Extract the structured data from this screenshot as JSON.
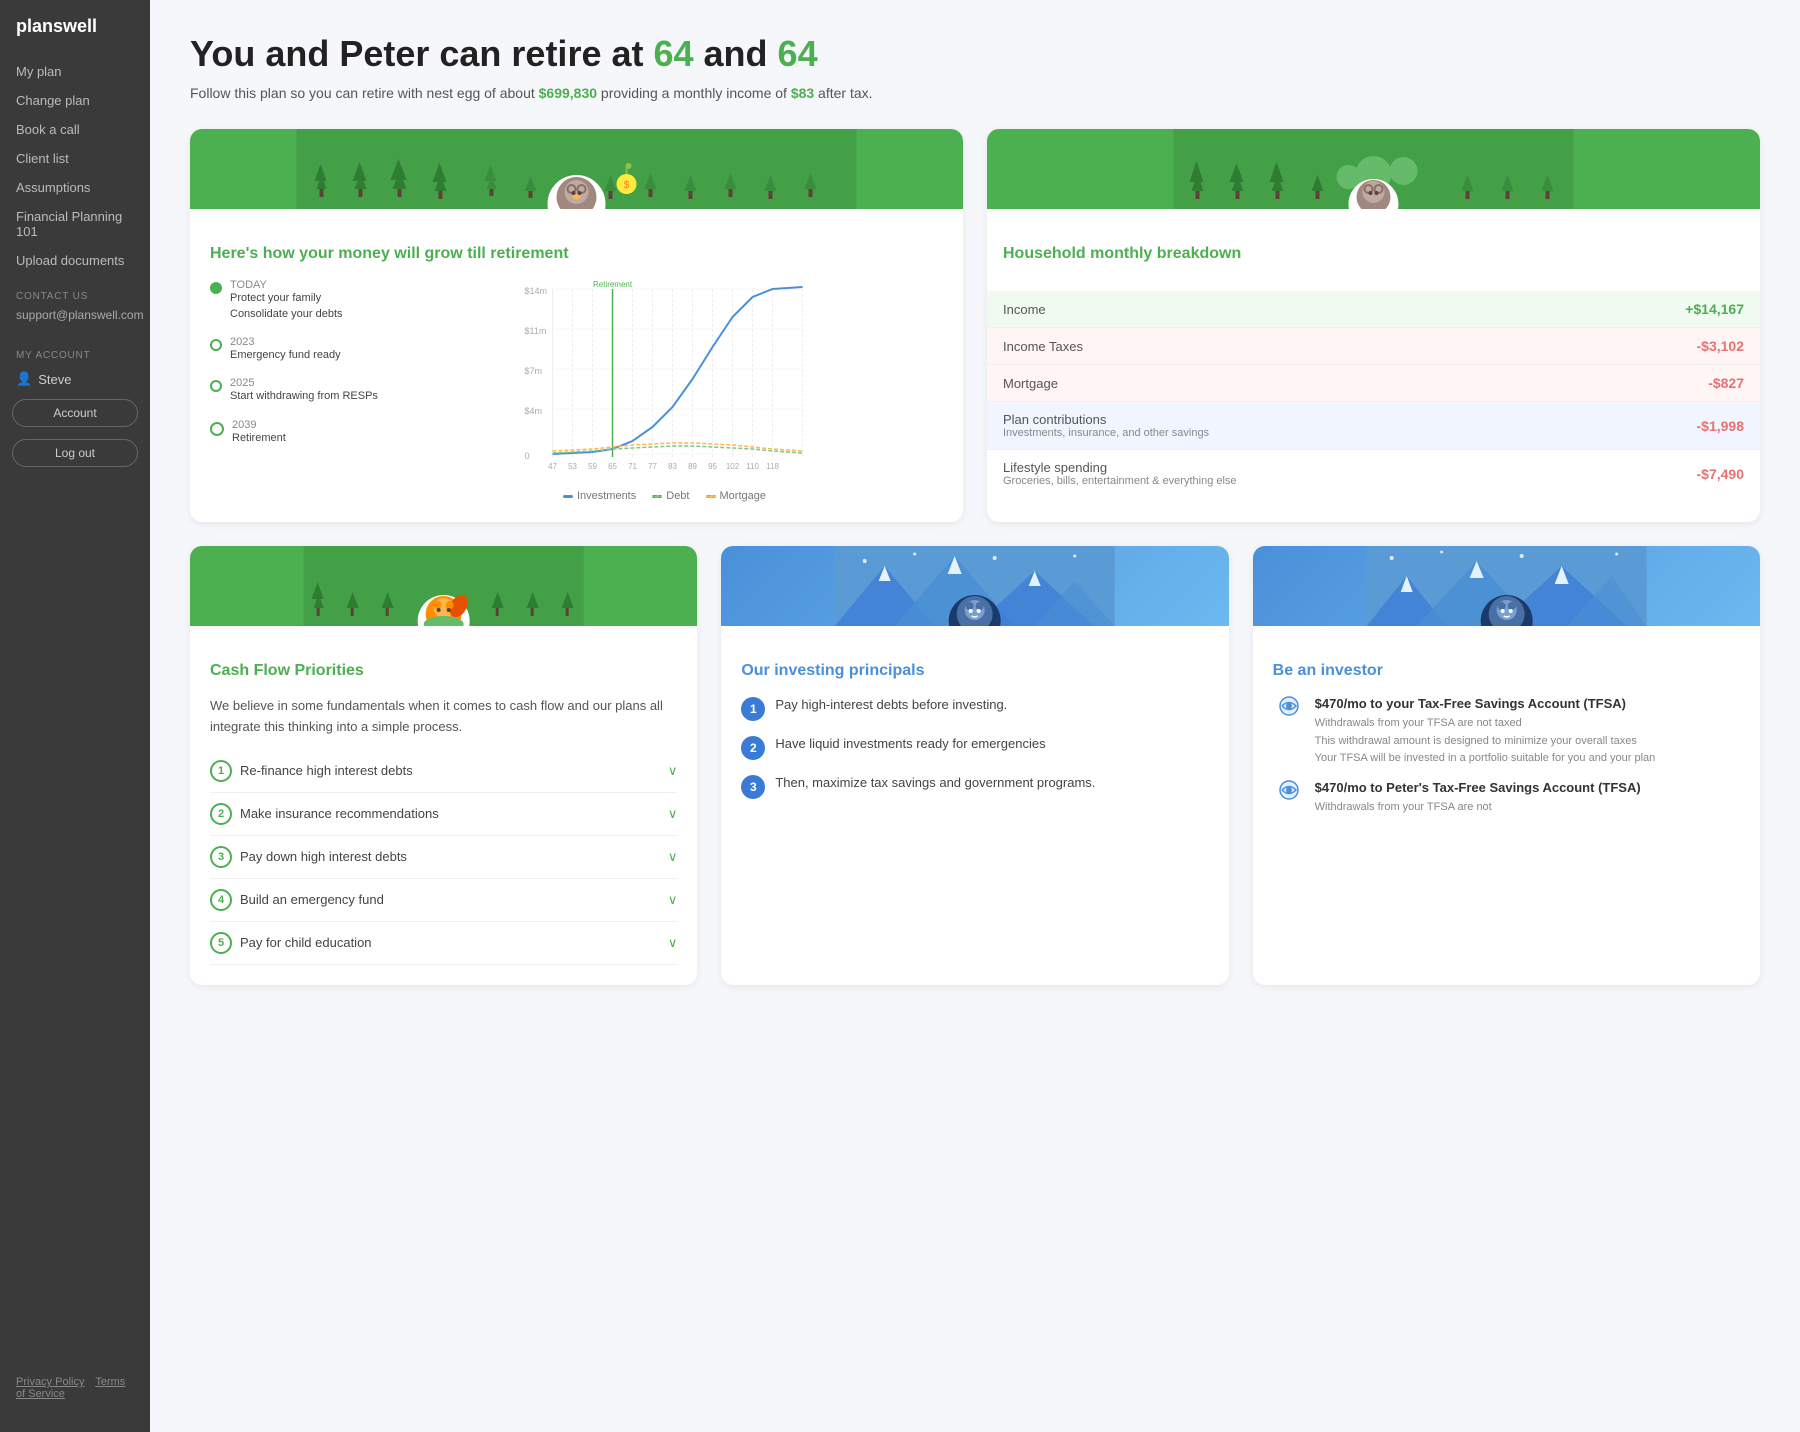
{
  "brand": "planswell",
  "sidebar": {
    "nav": [
      {
        "label": "My plan",
        "id": "my-plan"
      },
      {
        "label": "Change plan",
        "id": "change-plan"
      },
      {
        "label": "Book a call",
        "id": "book-call"
      },
      {
        "label": "Client list",
        "id": "client-list"
      },
      {
        "label": "Assumptions",
        "id": "assumptions"
      },
      {
        "label": "Financial Planning 101",
        "id": "fp101"
      },
      {
        "label": "Upload documents",
        "id": "upload-docs"
      }
    ],
    "contact_label": "CONTACT US",
    "contact_email": "support@planswell.com",
    "account_label": "MY ACCOUNT",
    "user_name": "Steve",
    "account_btn": "Account",
    "logout_btn": "Log out",
    "footer_links": [
      "Privacy Policy",
      "Terms of Service"
    ]
  },
  "hero": {
    "title_prefix": "You and Peter can retire at ",
    "age1": "64",
    "title_mid": " and ",
    "age2": "64",
    "subtitle_prefix": "Follow this plan so you can retire with nest egg of about ",
    "nest_egg": "$699,830",
    "subtitle_mid": " providing a monthly income of ",
    "monthly_income": "$83",
    "subtitle_suffix": " after tax."
  },
  "growth_card": {
    "title": "Here's how your money will grow till retirement",
    "timeline": [
      {
        "year": "TODAY",
        "filled": true,
        "events": [
          "Protect your family",
          "Consolidate your debts"
        ]
      },
      {
        "year": "2023",
        "filled": false,
        "events": [
          "Emergency fund ready"
        ]
      },
      {
        "year": "2025",
        "filled": false,
        "events": [
          "Start withdrawing from RESPs"
        ]
      },
      {
        "year": "2039",
        "filled": false,
        "events": [
          "Retirement"
        ]
      }
    ],
    "chart": {
      "y_labels": [
        "$14m",
        "$11m",
        "$7m",
        "$4m",
        "0"
      ],
      "x_labels": [
        "47",
        "53",
        "59",
        "65",
        "71",
        "77",
        "83",
        "89",
        "95",
        "102",
        "110",
        "118"
      ],
      "retirement_label": "Retirement"
    },
    "legend": [
      {
        "label": "Investments",
        "color": "blue"
      },
      {
        "label": "Debt",
        "color": "green"
      },
      {
        "label": "Mortgage",
        "color": "orange"
      }
    ]
  },
  "household_card": {
    "title": "Household monthly breakdown",
    "rows": [
      {
        "label": "Income",
        "amount": "+$14,167",
        "type": "green",
        "bg": "bg-green"
      },
      {
        "label": "Income Taxes",
        "amount": "-$3,102",
        "type": "red",
        "bg": "bg-red"
      },
      {
        "label": "Mortgage",
        "amount": "-$827",
        "type": "red",
        "bg": "bg-red"
      },
      {
        "label": "Plan contributions",
        "sublabel": "Investments, insurance, and other savings",
        "amount": "-$1,998",
        "type": "red",
        "bg": "bg-blue"
      },
      {
        "label": "Lifestyle spending",
        "sublabel": "Groceries, bills, entertainment & everything else",
        "amount": "-$7,490",
        "type": "red",
        "bg": ""
      }
    ]
  },
  "cashflow_card": {
    "title": "Cash Flow Priorities",
    "description": "We believe in some fundamentals when it comes to cash flow and our plans all integrate this thinking into a simple process.",
    "items": [
      {
        "num": 1,
        "label": "Re-finance high interest debts"
      },
      {
        "num": 2,
        "label": "Make insurance recommendations"
      },
      {
        "num": 3,
        "label": "Pay down high interest debts"
      },
      {
        "num": 4,
        "label": "Build an emergency fund"
      },
      {
        "num": 5,
        "label": "Pay for child education"
      }
    ]
  },
  "investing_card": {
    "title": "Our investing principals",
    "items": [
      {
        "num": 1,
        "text": "Pay high-interest debts before investing."
      },
      {
        "num": 2,
        "text": "Have liquid investments ready for emergencies"
      },
      {
        "num": 3,
        "text": "Then, maximize tax savings and government programs."
      }
    ]
  },
  "investor_card": {
    "title": "Be an investor",
    "items": [
      {
        "icon": "eye-icon",
        "title": "$470/mo to your Tax-Free Savings Account (TFSA)",
        "notes": [
          "Withdrawals from your TFSA are not taxed",
          "This withdrawal amount is designed to minimize your overall taxes",
          "Your TFSA will be invested in a portfolio suitable for you and your plan"
        ]
      },
      {
        "icon": "eye-icon",
        "title": "$470/mo to Peter's Tax-Free Savings Account (TFSA)",
        "notes": [
          "Withdrawals from your TFSA are not"
        ]
      }
    ]
  }
}
